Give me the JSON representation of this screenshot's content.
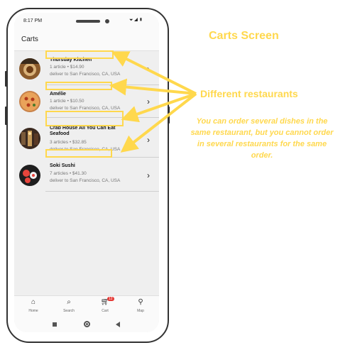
{
  "status_bar": {
    "time": "8:17 PM",
    "icons": "⏷◢▮"
  },
  "app_bar": {
    "title": "Carts"
  },
  "carts": [
    {
      "name": "Thursday Kitchen",
      "line1": "1 article • $14.90",
      "line2": "deliver to San Francisco, CA, USA"
    },
    {
      "name": "Amélie",
      "line1": "1 article • $10.50",
      "line2": "deliver to San Francisco, CA, USA"
    },
    {
      "name": "Crab House All You Can Eat Seafood",
      "line1": "3 articles • $32.85",
      "line2": "deliver to San Francisco, CA, USA"
    },
    {
      "name": "Soki Sushi",
      "line1": "7 articles • $41.30",
      "line2": "deliver to San Francisco, CA, USA"
    }
  ],
  "bottom_nav": {
    "items": [
      {
        "label": "Home",
        "icon": "home-icon"
      },
      {
        "label": "Search",
        "icon": "search-icon"
      },
      {
        "label": "Cart",
        "icon": "cart-icon",
        "badge": "12"
      },
      {
        "label": "Map",
        "icon": "map-pin-icon"
      }
    ]
  },
  "annotations": {
    "title": "Carts Screen",
    "different": "Different restaurants",
    "note": "You can order several dishes in the same restaurant, but you cannot order in several restaurants for the same order."
  },
  "colors": {
    "annotation": "#ffd84d",
    "badge": "#e53935"
  }
}
